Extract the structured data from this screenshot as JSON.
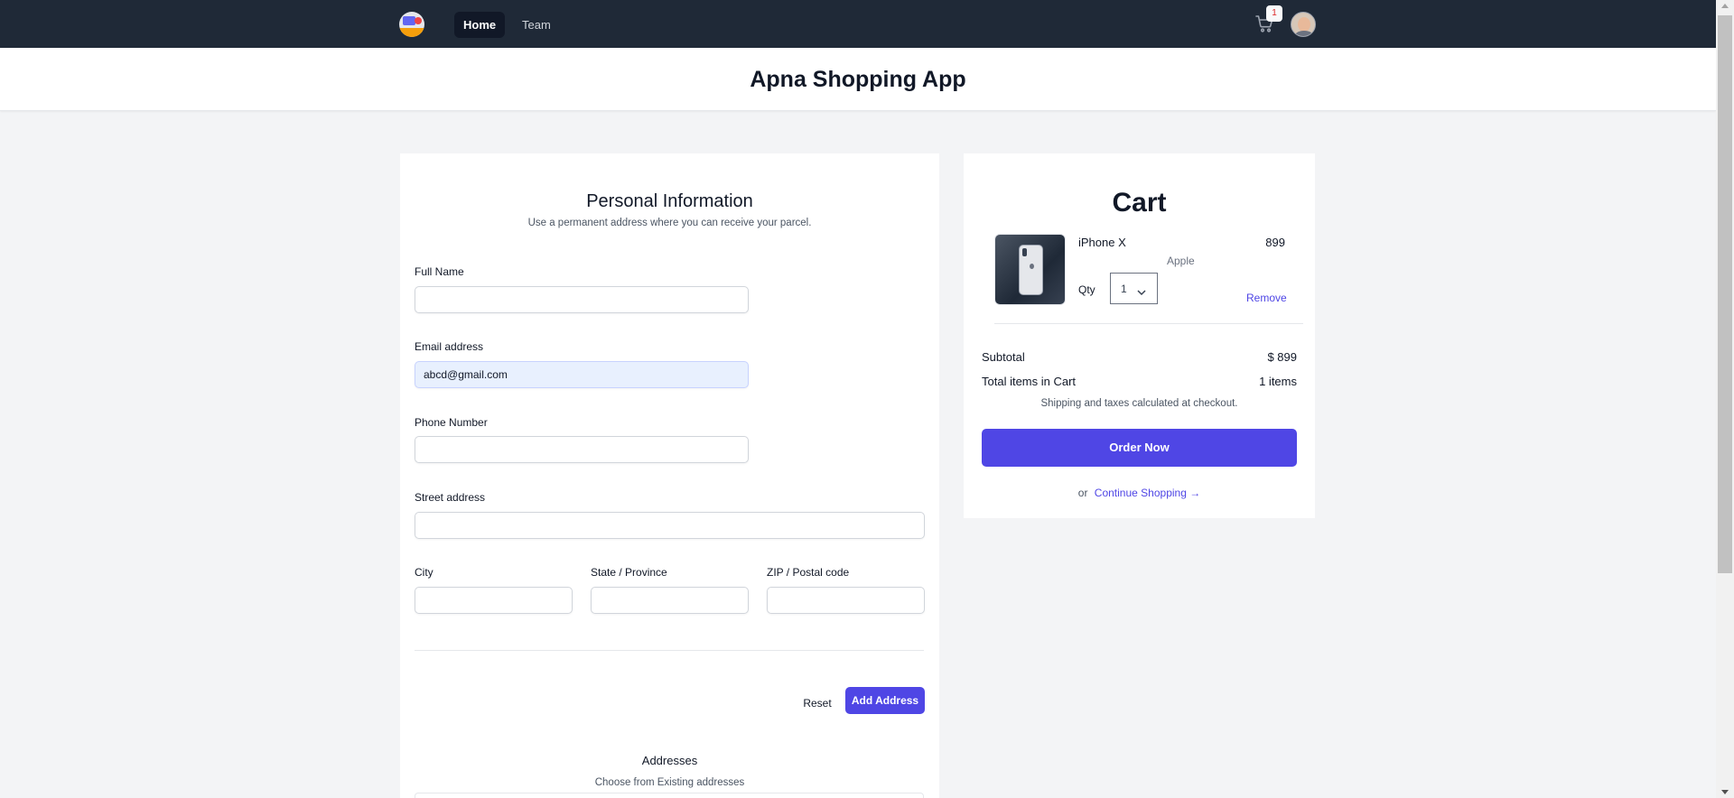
{
  "nav": {
    "links": [
      {
        "label": "Home",
        "active": true
      },
      {
        "label": "Team",
        "active": false
      }
    ],
    "cart_count": "1",
    "icons": {
      "logo": "shopping-logo",
      "cart": "shopping-cart-icon",
      "avatar": "user-avatar"
    }
  },
  "header": {
    "title": "Apna Shopping App"
  },
  "form": {
    "title": "Personal Information",
    "subtitle": "Use a permanent address where you can receive your parcel.",
    "fields": {
      "full_name": {
        "label": "Full Name",
        "value": ""
      },
      "email": {
        "label": "Email address",
        "value": "abcd@gmail.com"
      },
      "phone": {
        "label": "Phone Number",
        "value": ""
      },
      "street": {
        "label": "Street address",
        "value": ""
      },
      "city": {
        "label": "City",
        "value": ""
      },
      "state": {
        "label": "State / Province",
        "value": ""
      },
      "zip": {
        "label": "ZIP / Postal code",
        "value": ""
      }
    },
    "reset_label": "Reset",
    "add_label": "Add Address",
    "addresses_title": "Addresses",
    "addresses_subtitle": "Choose from Existing addresses"
  },
  "cart": {
    "title": "Cart",
    "item": {
      "name": "iPhone X",
      "price": "899",
      "brand": "Apple",
      "qty_label": "Qty",
      "qty": "1",
      "remove_label": "Remove"
    },
    "subtotal_label": "Subtotal",
    "subtotal_value": "$ 899",
    "items_label": "Total items in Cart",
    "items_value": "1 items",
    "shipping_note": "Shipping and taxes calculated at checkout.",
    "order_label": "Order Now",
    "or_label": "or",
    "continue_label": "Continue Shopping →"
  },
  "colors": {
    "nav_bg": "#1f2937",
    "accent": "#4f46e5",
    "page_bg": "#f3f4f6"
  }
}
